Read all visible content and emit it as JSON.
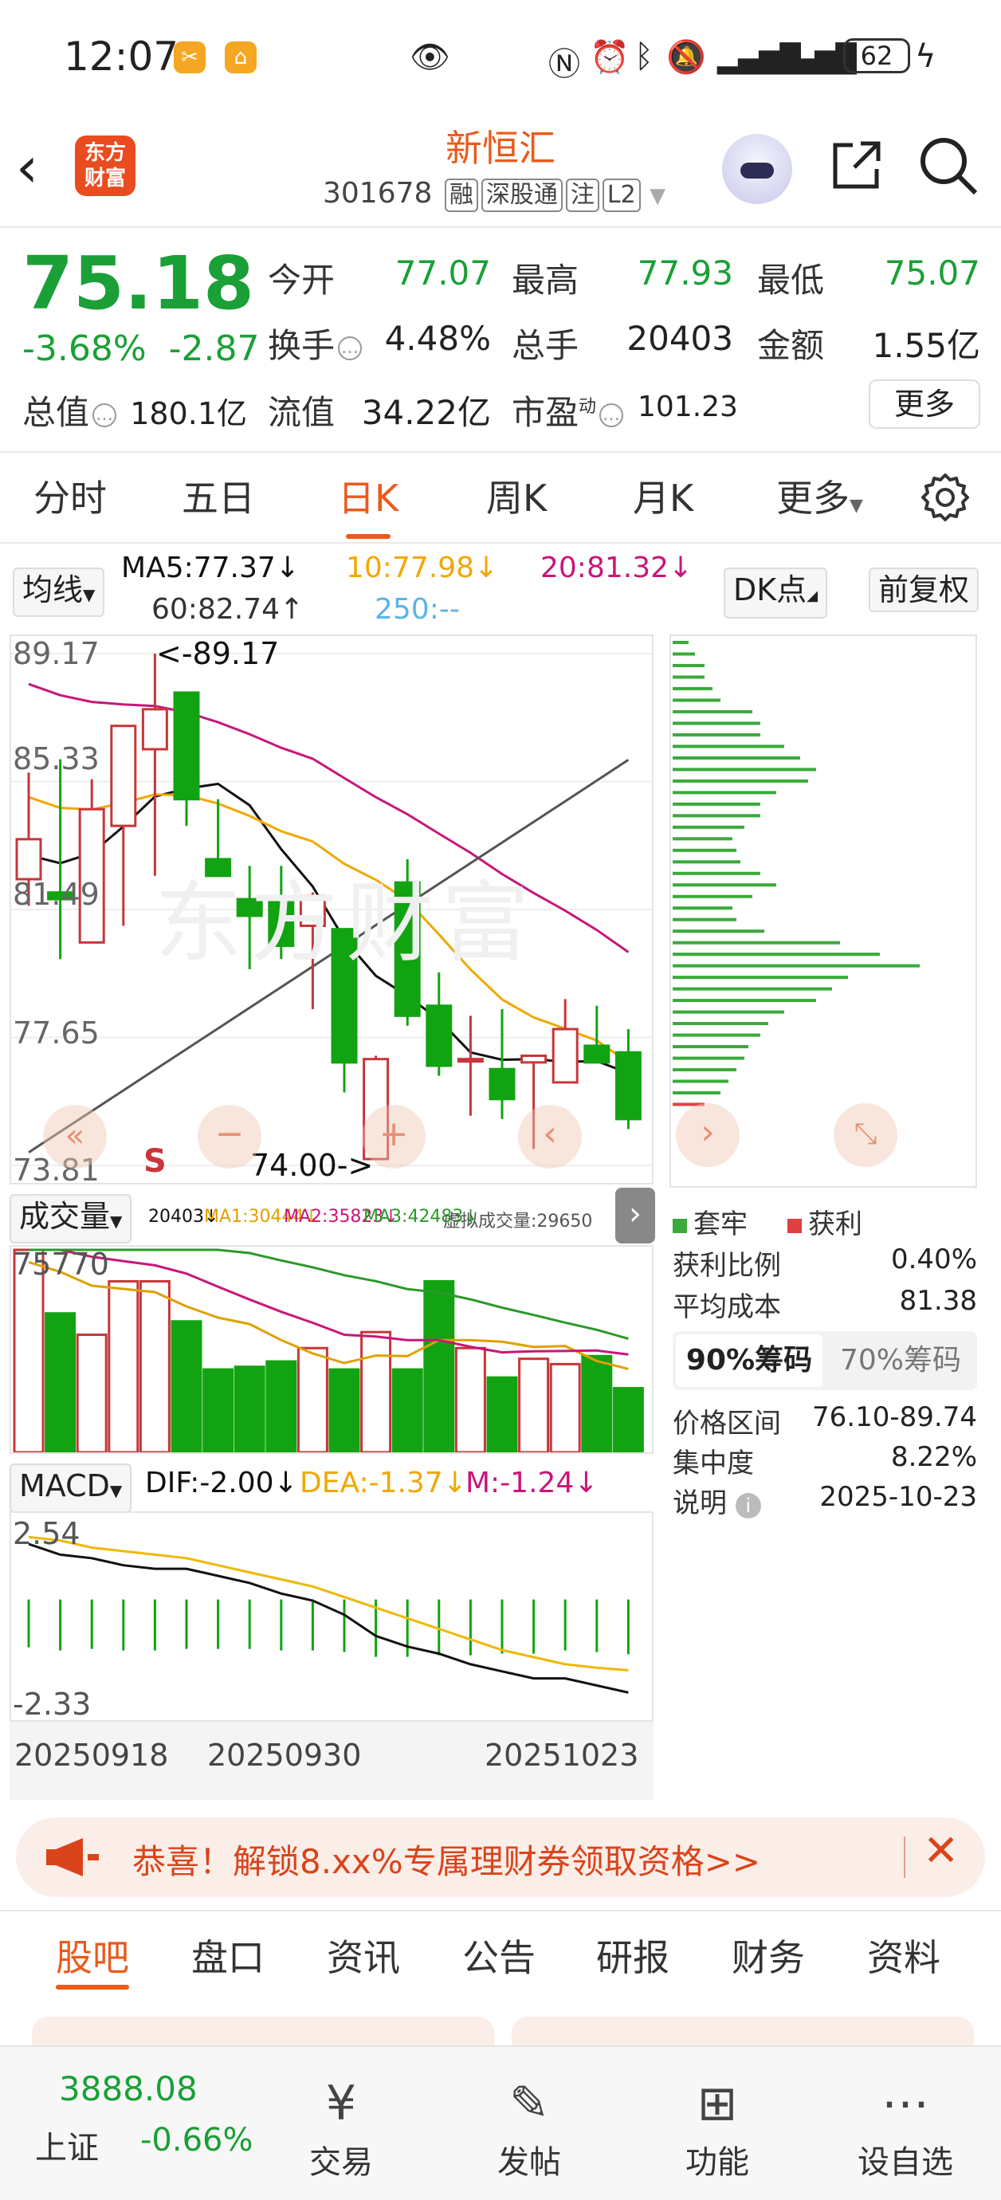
{
  "status": {
    "time": "12:07",
    "battery": "62",
    "badge1": "✂",
    "badge2": "⌂",
    "icons": [
      "eye-icon",
      "nfc-icon",
      "alarm-icon",
      "bluetooth-icon",
      "mute-icon",
      "signal-icon",
      "signal-icon",
      "battery-icon",
      "charging-icon"
    ]
  },
  "header": {
    "logo_line1": "东方",
    "logo_line2": "财富",
    "stock_name": "新恒汇",
    "stock_code": "301678",
    "tags": [
      "融",
      "深股通",
      "注",
      "L2"
    ]
  },
  "quote": {
    "price": "75.18",
    "change_pct": "-3.68%",
    "change_amt": "-2.87",
    "open_label": "今开",
    "open": "77.07",
    "high_label": "最高",
    "high": "77.93",
    "low_label": "最低",
    "low": "75.07",
    "turnover_rate_label": "换手",
    "turnover_rate": "4.48%",
    "volume_label": "总手",
    "volume": "20403",
    "amount_label": "金额",
    "amount": "1.55亿",
    "mcap_label": "总值",
    "mcap": "180.1亿",
    "float_label": "流值",
    "float_value": "34.22亿",
    "pe_label": "市盈",
    "pe_sup": "动",
    "pe": "101.23",
    "more_label": "更多"
  },
  "tabs": {
    "items": [
      "分时",
      "五日",
      "日K",
      "周K",
      "月K",
      "更多"
    ],
    "active": "日K"
  },
  "kchart": {
    "indicator_select": "均线",
    "ma5": "MA5:77.37↓",
    "ma10": "10:77.98↓",
    "ma20": "20:81.32↓",
    "ma60": "60:82.74↑",
    "ma250": "250:--",
    "dk_label": "DK点",
    "adjust_label": "前复权",
    "y_ticks": [
      "89.17",
      "85.33",
      "81.49",
      "77.65",
      "73.81"
    ],
    "high_mark": "<-89.17",
    "low_mark": "74.00->",
    "s_mark": "S",
    "watermark": "东方财富",
    "colors": {
      "up": "#c8363a",
      "down": "#12a312",
      "ma5": "#111111",
      "ma10": "#f0a800",
      "ma20": "#c8167a",
      "ma60": "#555555"
    }
  },
  "volume": {
    "select": "成交量",
    "legend": [
      "20403↓",
      "MA1:30444↓",
      "MA2:35823↓",
      "MA3:42483↓",
      "虚拟成交量:29650"
    ],
    "top_label": "75770"
  },
  "macd": {
    "select": "MACD",
    "dif": "DIF:-2.00↓",
    "dea": "DEA:-1.37↓",
    "m": "M:-1.24↓",
    "top": "2.54",
    "bottom": "-2.33",
    "dates": [
      "20250918",
      "20250930",
      "20251023"
    ]
  },
  "chip": {
    "legend_locked": "套牢",
    "legend_profit": "获利",
    "profit_ratio_label": "获利比例",
    "profit_ratio": "0.40%",
    "avg_cost_label": "平均成本",
    "avg_cost": "81.38",
    "tab90": "90%筹码",
    "tab70": "70%筹码",
    "range_label": "价格区间",
    "range": "76.10-89.74",
    "concentration_label": "集中度",
    "concentration": "8.22%",
    "note_label": "说明",
    "date": "2025-10-23"
  },
  "banner": {
    "text": "恭喜！解锁8.xx%专属理财券领取资格>>"
  },
  "bottom_tabs": [
    "股吧",
    "盘口",
    "资讯",
    "公告",
    "研报",
    "财务",
    "资料"
  ],
  "bottom_nav": {
    "index_value": "3888.08",
    "index_name": "上证",
    "index_change": "-0.66%",
    "trade": "交易",
    "post": "发帖",
    "functions": "功能",
    "watchlist": "设自选"
  },
  "chart_data": {
    "type": "candlestick",
    "ylim": [
      73.81,
      89.17
    ],
    "candles": [
      {
        "o": 82.4,
        "h": 85.6,
        "l": 81.6,
        "c": 83.6
      },
      {
        "o": 82.0,
        "h": 86.0,
        "l": 80.0,
        "c": 81.8
      },
      {
        "o": 80.5,
        "h": 85.4,
        "l": 80.5,
        "c": 84.5
      },
      {
        "o": 84.0,
        "h": 87.0,
        "l": 81.0,
        "c": 87.0
      },
      {
        "o": 86.3,
        "h": 89.17,
        "l": 82.5,
        "c": 87.5
      },
      {
        "o": 88.0,
        "h": 88.0,
        "l": 84.0,
        "c": 84.8
      },
      {
        "o": 83.0,
        "h": 84.8,
        "l": 82.5,
        "c": 82.5
      },
      {
        "o": 81.8,
        "h": 82.8,
        "l": 79.7,
        "c": 81.3
      },
      {
        "o": 81.8,
        "h": 82.8,
        "l": 80.0,
        "c": 80.4
      },
      {
        "o": 81.0,
        "h": 82.0,
        "l": 78.5,
        "c": 81.9
      },
      {
        "o": 80.9,
        "h": 80.9,
        "l": 76.0,
        "c": 76.9
      },
      {
        "o": 74.0,
        "h": 77.1,
        "l": 74.0,
        "c": 77.0
      },
      {
        "o": 82.3,
        "h": 83.0,
        "l": 78.0,
        "c": 78.3
      },
      {
        "o": 78.6,
        "h": 79.6,
        "l": 76.5,
        "c": 76.8
      },
      {
        "o": 77.0,
        "h": 78.3,
        "l": 75.3,
        "c": 77.0
      },
      {
        "o": 76.7,
        "h": 78.5,
        "l": 75.2,
        "c": 75.8
      },
      {
        "o": 76.9,
        "h": 77.1,
        "l": 74.3,
        "c": 77.1
      },
      {
        "o": 76.3,
        "h": 78.8,
        "l": 76.3,
        "c": 77.9
      },
      {
        "o": 77.4,
        "h": 78.6,
        "l": 76.9,
        "c": 76.9
      },
      {
        "o": 77.2,
        "h": 77.9,
        "l": 74.9,
        "c": 75.2
      }
    ],
    "volume_max": 75770,
    "volumes": [
      75770,
      52000,
      44000,
      64000,
      64000,
      49000,
      31000,
      32000,
      34000,
      39000,
      31000,
      45000,
      31000,
      64000,
      39000,
      28000,
      35000,
      33000,
      36000,
      24000
    ],
    "macd_range": [
      -2.33,
      2.54
    ],
    "dif": [
      2.2,
      1.9,
      1.8,
      1.6,
      1.5,
      1.5,
      1.3,
      1.1,
      0.8,
      0.6,
      0.2,
      -0.4,
      -0.7,
      -0.9,
      -1.2,
      -1.4,
      -1.6,
      -1.6,
      -1.8,
      -2.0
    ],
    "dea": [
      2.4,
      2.3,
      2.1,
      2.0,
      1.9,
      1.8,
      1.6,
      1.4,
      1.2,
      1.0,
      0.7,
      0.4,
      0.1,
      -0.2,
      -0.5,
      -0.8,
      -1.0,
      -1.2,
      -1.3,
      -1.37
    ]
  }
}
